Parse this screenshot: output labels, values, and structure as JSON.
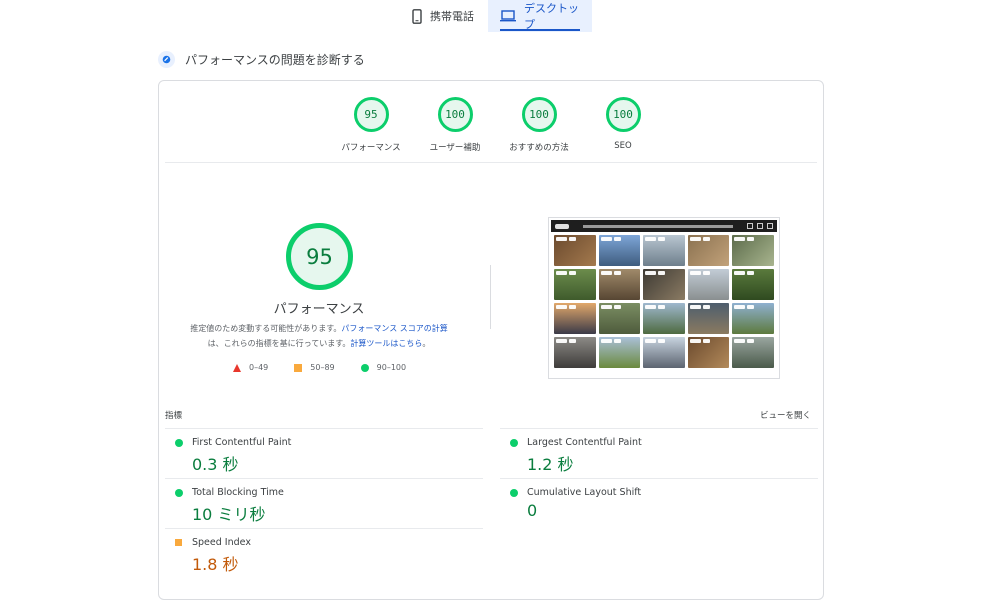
{
  "tabs": [
    {
      "label": "携帯電話",
      "icon": "phone-icon",
      "active": false
    },
    {
      "label": "デスクトップ",
      "icon": "laptop-icon",
      "active": true
    }
  ],
  "diagnose": {
    "label": "パフォーマンスの問題を診断する",
    "icon": "lighthouse-icon"
  },
  "scores": [
    {
      "value": "95",
      "label": "パフォーマンス"
    },
    {
      "value": "100",
      "label": "ユーザー補助"
    },
    {
      "value": "100",
      "label": "おすすめの方法"
    },
    {
      "value": "100",
      "label": "SEO"
    }
  ],
  "performance": {
    "score": "95",
    "title": "パフォーマンス",
    "desc_1": "推定値のため変動する可能性があります。",
    "link_1": "パフォーマンス スコアの計算",
    "desc_2": "は、これらの指標を基に行っています。",
    "link_2": "計算ツールはこちら",
    "desc_3": "。"
  },
  "legend": [
    {
      "range": "0–49",
      "color": "#e8372c",
      "shape": "triangle"
    },
    {
      "range": "50–89",
      "color": "#f9a93d",
      "shape": "square"
    },
    {
      "range": "90–100",
      "color": "#0cce6b",
      "shape": "circle"
    }
  ],
  "metrics": {
    "header": "指標",
    "open_view": "ビューを開く",
    "items": [
      {
        "name": "First Contentful Paint",
        "value": "0.3 秒",
        "status": "good"
      },
      {
        "name": "Largest Contentful Paint",
        "value": "1.2 秒",
        "status": "good"
      },
      {
        "name": "Total Blocking Time",
        "value": "10 ミリ秒",
        "status": "good"
      },
      {
        "name": "Cumulative Layout Shift",
        "value": "0",
        "status": "good"
      },
      {
        "name": "Speed Index",
        "value": "1.8 秒",
        "status": "average"
      }
    ]
  },
  "colors": {
    "accent": "#1a56c8",
    "good": "#0cce6b",
    "average": "#f9a93d",
    "fail": "#e8372c"
  }
}
